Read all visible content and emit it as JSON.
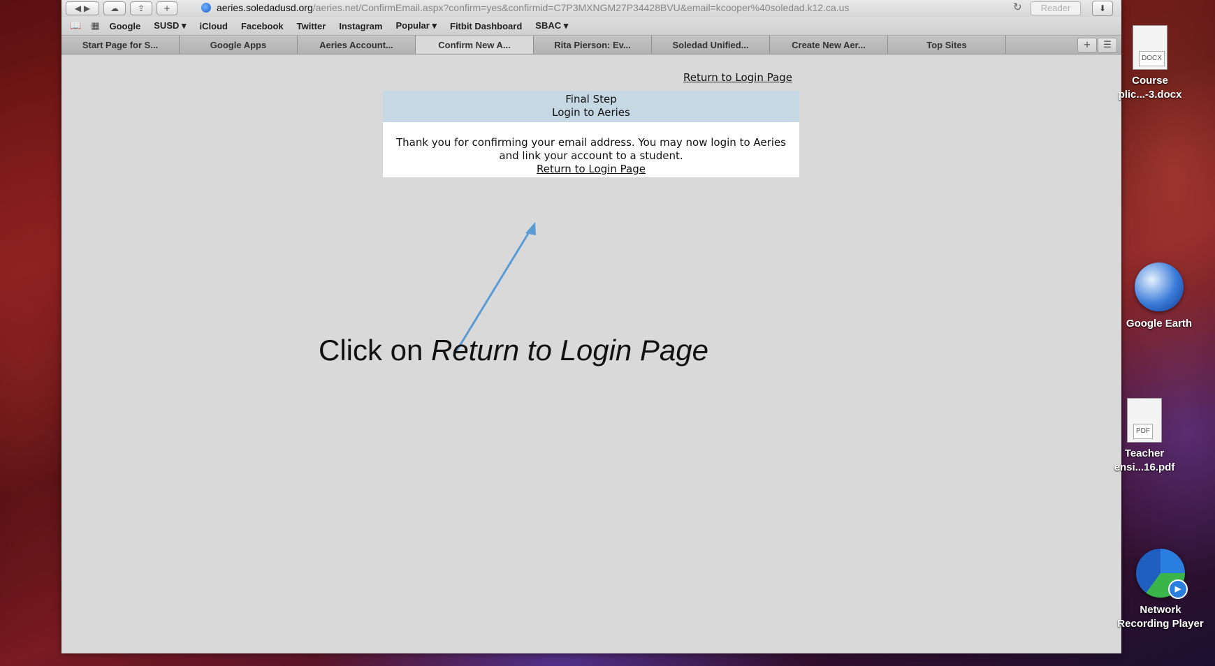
{
  "browser": {
    "address": {
      "host": "aeries.soledadusd.org",
      "path": "/aeries.net/ConfirmEmail.aspx?confirm=yes&confirmid=C7P3MXNGM27P34428BVU&email=kcooper%40soledad.k12.ca.us"
    },
    "reader_label": "Reader",
    "bookmarks": [
      "Google",
      "SUSD ▾",
      "iCloud",
      "Facebook",
      "Twitter",
      "Instagram",
      "Popular ▾",
      "Fitbit Dashboard",
      "SBAC ▾"
    ],
    "tabs": [
      {
        "label": "Start Page for S..."
      },
      {
        "label": "Google Apps"
      },
      {
        "label": "Aeries Account..."
      },
      {
        "label": "Confirm New A..."
      },
      {
        "label": "Rita Pierson: Ev..."
      },
      {
        "label": "Soledad Unified..."
      },
      {
        "label": "Create New Aer..."
      },
      {
        "label": "Top Sites"
      }
    ]
  },
  "page": {
    "top_link": "Return to Login Page",
    "panel": {
      "heading_line1": "Final Step",
      "heading_line2": "Login to Aeries",
      "message_line1": "Thank you for confirming your email address. You may now login to Aeries",
      "message_line2": "and link your account to a student.",
      "link": "Return to Login Page"
    },
    "caption_prefix": "Click on ",
    "caption_emphasis": "Return to Login Page"
  },
  "desktop": {
    "icons": [
      {
        "label1": "Course",
        "label2": "plic...-3.docx",
        "tag": "DOCX"
      },
      {
        "label1": "Google Earth"
      },
      {
        "label1": "Teacher",
        "label2": "ensi...16.pdf",
        "tag": "PDF"
      },
      {
        "label1": "Network",
        "label2": "Recording Player"
      }
    ]
  },
  "colors": {
    "panel_header": "#c7d8e5",
    "arrow": "#5b9bd5",
    "page_background": "#d9d9d9"
  }
}
